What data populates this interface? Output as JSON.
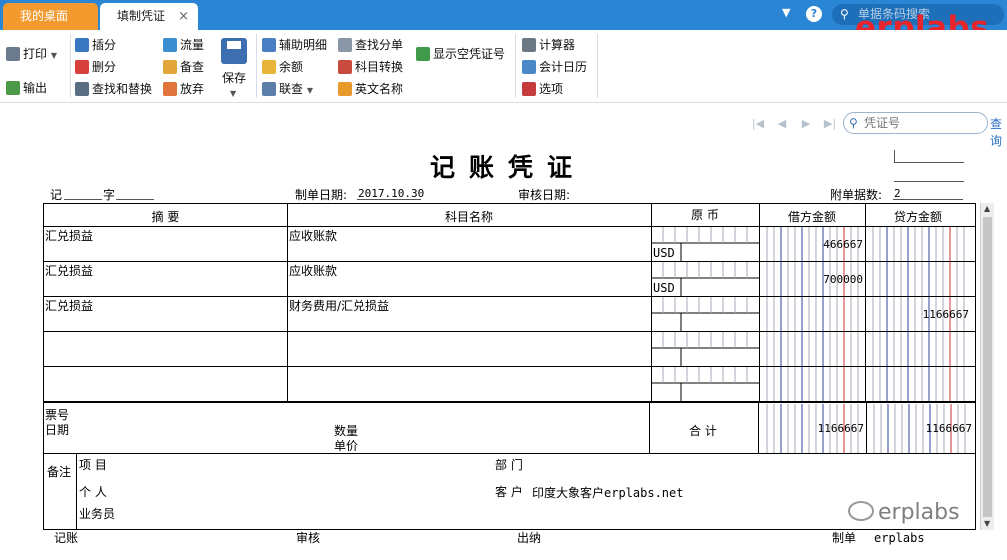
{
  "tabs": {
    "desktop": "我的桌面",
    "voucher": "填制凭证",
    "close": "×"
  },
  "topbar": {
    "search_placeholder": "单据条码搜索",
    "dropdown": "▼",
    "help": "?"
  },
  "logo": "erplabs",
  "ribbon": {
    "print": "打印",
    "export": "输出",
    "insert": "插分",
    "delete": "删分",
    "find_replace": "查找和替换",
    "flow": "流量",
    "backup": "备查",
    "discard": "放弃",
    "save": "保存",
    "aux_detail": "辅助明细",
    "balance": "余额",
    "link": "联查",
    "find_entry": "查找分单",
    "subject_convert": "科目转换",
    "english_name": "英文名称",
    "show_empty": "显示空凭证号",
    "calculator": "计算器",
    "calendar": "会计日历",
    "options": "选项"
  },
  "voucher_search": {
    "placeholder": "凭证号",
    "query": "查询"
  },
  "voucher": {
    "title": "记账凭证",
    "type_label": "记",
    "num_label": "字",
    "date_label": "制单日期:",
    "date": "2017.10.30",
    "audit_date_label": "审核日期:",
    "attach_label": "附单据数:",
    "attach": "2",
    "columns": {
      "summary": "摘 要",
      "subject": "科目名称",
      "original": "原 币",
      "debit": "借方金额",
      "credit": "贷方金额"
    },
    "rows": [
      {
        "summary": "汇兑损益",
        "subject": "应收账款",
        "currency": "USD",
        "debit": "466667",
        "credit": ""
      },
      {
        "summary": "汇兑损益",
        "subject": "应收账款",
        "currency": "USD",
        "debit": "700000",
        "credit": ""
      },
      {
        "summary": "汇兑损益",
        "subject": "财务费用/汇兑损益",
        "currency": "",
        "debit": "",
        "credit": "1166667"
      },
      {
        "summary": "",
        "subject": "",
        "currency": "",
        "debit": "",
        "credit": ""
      },
      {
        "summary": "",
        "subject": "",
        "currency": "",
        "debit": "",
        "credit": ""
      }
    ],
    "bill_no_label": "票号",
    "bill_date_label": "日期",
    "qty_label": "数量",
    "price_label": "单价",
    "total_label": "合 计",
    "total_debit": "1166667",
    "total_credit": "1166667",
    "remarks_label": "备注",
    "project_label": "项 目",
    "dept_label": "部 门",
    "person_label": "个 人",
    "customer_label": "客 户",
    "customer": "印度大象客户erplabs.net",
    "salesman_label": "业务员"
  },
  "footer": {
    "bookkeeping": "记账",
    "audit": "审核",
    "cashier": "出纳",
    "maker": "制单",
    "maker_name": "erplabs"
  },
  "watermark": "erplabs"
}
